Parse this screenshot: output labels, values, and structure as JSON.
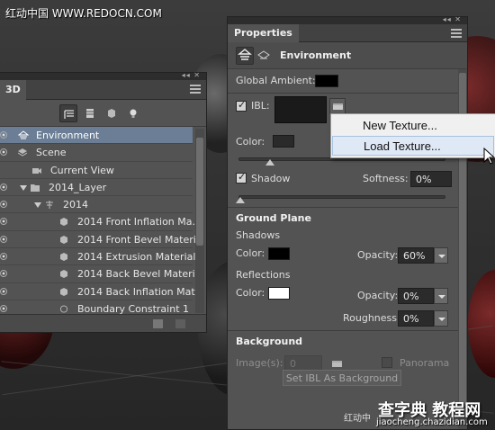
{
  "watermark_top": "红动中国 WWW.REDOCN.COM",
  "panel3d": {
    "tab_label": "3D",
    "rows": [
      {
        "label": "Environment",
        "selected": true
      },
      {
        "label": "Scene"
      },
      {
        "label": "Current View"
      },
      {
        "label": "2014_Layer"
      },
      {
        "label": "2014"
      },
      {
        "label": "2014 Front Inflation Ma..."
      },
      {
        "label": "2014 Front Bevel Material"
      },
      {
        "label": "2014 Extrusion Material"
      },
      {
        "label": "2014 Back Bevel Material"
      },
      {
        "label": "2014 Back Inflation Mat..."
      },
      {
        "label": "Boundary Constraint 1"
      }
    ]
  },
  "properties": {
    "tab_label": "Properties",
    "header_title": "Environment",
    "global_ambient_label": "Global Ambient:",
    "ibl_label": "IBL:",
    "color_label": "Color:",
    "shadow_label": "Shadow",
    "softness_label": "Softness:",
    "softness_value": "0%",
    "ground_plane_header": "Ground Plane",
    "shadows_label": "Shadows",
    "shadows_color_label": "Color:",
    "shadows_opacity_label": "Opacity:",
    "shadows_opacity_value": "60%",
    "reflections_label": "Reflections",
    "reflections_color_label": "Color:",
    "reflections_opacity_label": "Opacity:",
    "reflections_opacity_value": "0%",
    "roughness_label": "Roughness:",
    "roughness_value": "0%",
    "background_header": "Background",
    "images_label": "Image(s):",
    "images_value": "0",
    "panorama_label": "Panorama",
    "set_ibl_button": "Set IBL As Background"
  },
  "context_menu": {
    "items": [
      "New Texture...",
      "Load Texture..."
    ],
    "highlighted_index": 1
  },
  "watermark_bottom": {
    "small": "红动中",
    "logo": "查字典 教程网",
    "url": "jiaocheng.chazidian.com"
  },
  "colors": {
    "selection": "#6b7e95",
    "panel_bg": "#535353",
    "menu_highlight": "#dfe8f5"
  }
}
